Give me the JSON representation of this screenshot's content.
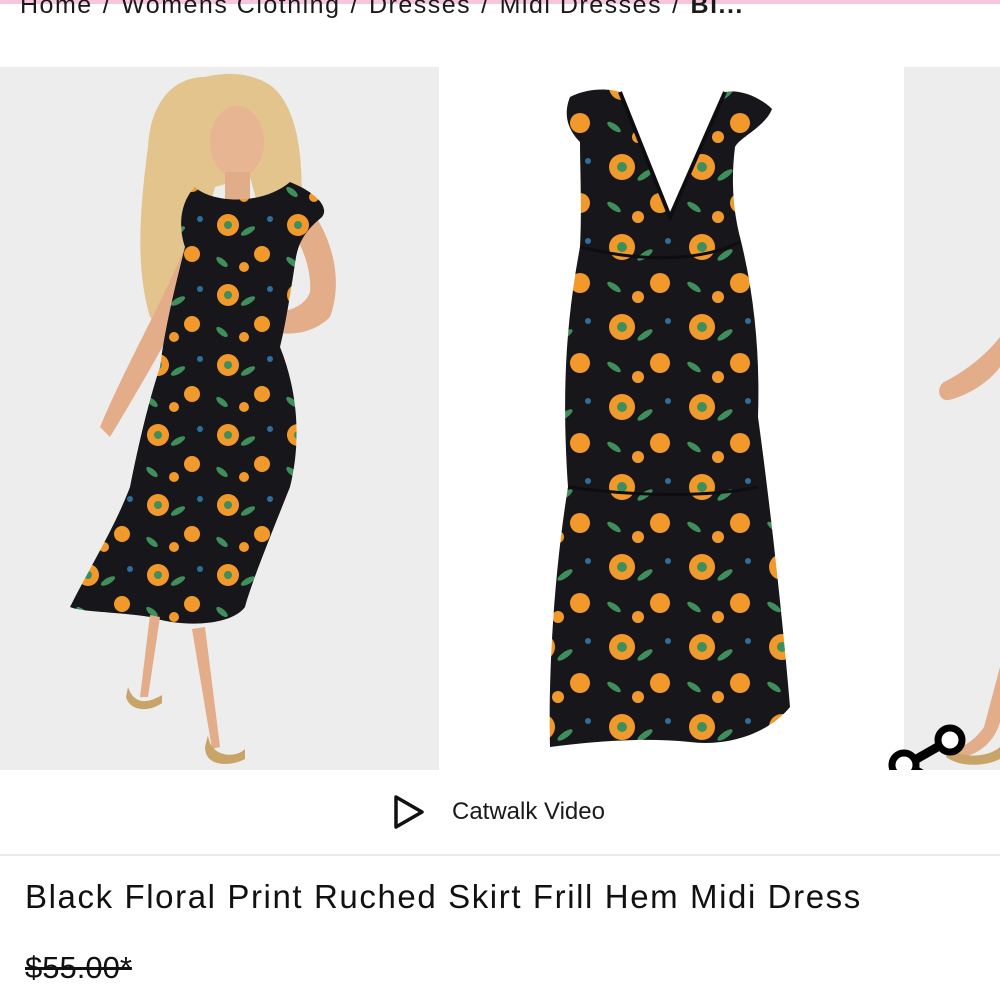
{
  "breadcrumb": {
    "items": [
      {
        "label": "Home"
      },
      {
        "label": "Womens Clothing"
      },
      {
        "label": "Dresses"
      },
      {
        "label": "Midi Dresses"
      }
    ],
    "separator": "/",
    "current": "Bl..."
  },
  "gallery": {
    "images": [
      {
        "icon": "model-wearing-dress-image"
      },
      {
        "icon": "dress-product-image"
      },
      {
        "icon": "model-partial-image"
      }
    ],
    "share_icon": "share-icon",
    "print_colors": {
      "base": "#17171b",
      "flower": "#f19a2b",
      "leaf": "#3f8f5b",
      "blue": "#2c6f9e"
    }
  },
  "video": {
    "label": "Catwalk Video",
    "icon": "play-icon"
  },
  "product": {
    "title": "Black Floral Print Ruched Skirt Frill Hem Midi Dress",
    "price": "$55.00*"
  },
  "theme": {
    "accent": "#f7c6dc"
  }
}
